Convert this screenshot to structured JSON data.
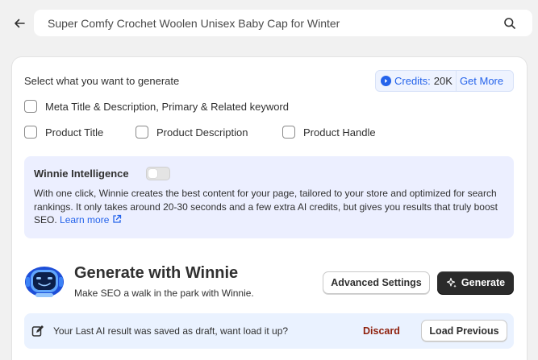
{
  "search": {
    "value": "Super Comfy Crochet Woolen Unisex Baby Cap for Winter"
  },
  "icons": {
    "back": "arrow-left-icon",
    "search": "magnifier-icon",
    "credits": "play-circle-icon",
    "external": "external-link-icon",
    "sparkle": "sparkle-icon",
    "draft": "edit-note-icon"
  },
  "panel": {
    "select_label": "Select what you want to generate",
    "credits": {
      "label": "Credits:",
      "value": "20K",
      "more": "Get More"
    },
    "options": [
      {
        "label": "Meta Title & Description, Primary & Related keyword",
        "checked": false
      },
      {
        "label": "Product Title",
        "checked": false
      },
      {
        "label": "Product Description",
        "checked": false
      },
      {
        "label": "Product Handle",
        "checked": false
      }
    ],
    "intelligence": {
      "title": "Winnie Intelligence",
      "enabled": false,
      "text": "With one click, Winnie creates the best content for your page, tailored to your store and optimized for search rankings. It only takes around 20-30 seconds and a few extra AI credits, but gives you results that truly boost SEO. ",
      "link": "Learn more"
    },
    "generate": {
      "title": "Generate with Winnie",
      "subtitle": "Make SEO a walk in the park with Winnie.",
      "advanced_label": "Advanced Settings",
      "generate_label": "Generate"
    },
    "draft": {
      "text": "Your Last AI result was saved as draft, want load it up?",
      "discard_label": "Discard",
      "load_label": "Load Previous"
    }
  },
  "colors": {
    "accent": "#2463eb",
    "intel_bg": "#ecefff",
    "draft_bg": "#eaf2ff",
    "discard": "#8e1f0b",
    "primary_button": "#2b2b2b"
  }
}
